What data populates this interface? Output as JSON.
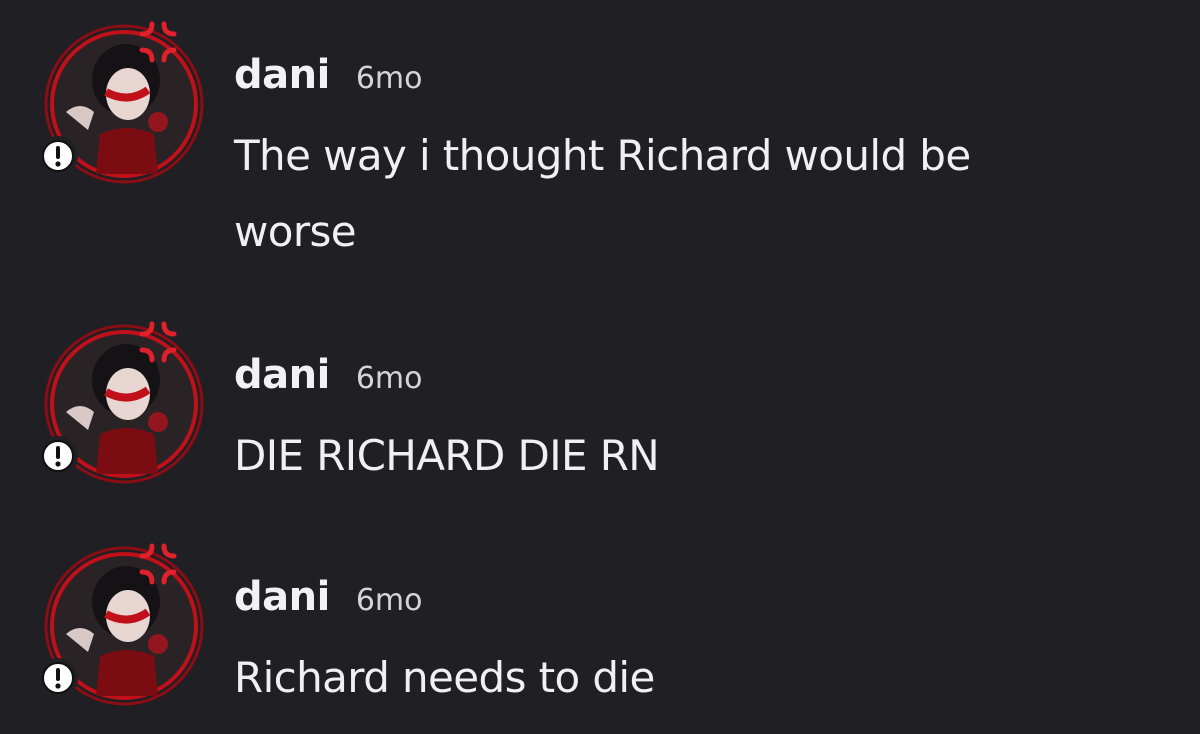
{
  "messages": [
    {
      "author": "dani",
      "timestamp": "6mo",
      "content_line1": "The way i thought Richard would be",
      "content_line2": "worse"
    },
    {
      "author": "dani",
      "timestamp": "6mo",
      "content_line1": "DIE RICHARD DIE RN"
    },
    {
      "author": "dani",
      "timestamp": "6mo",
      "content_line1": "Richard needs to die"
    }
  ],
  "colors": {
    "background": "#1f1f24",
    "avatar_ring": "#c0101a",
    "badge_bg": "#ffffff",
    "anger_symbol": "#e0202a"
  },
  "icons": {
    "badge": "exclamation-badge-icon",
    "decoration": "anger-symbol-icon"
  }
}
